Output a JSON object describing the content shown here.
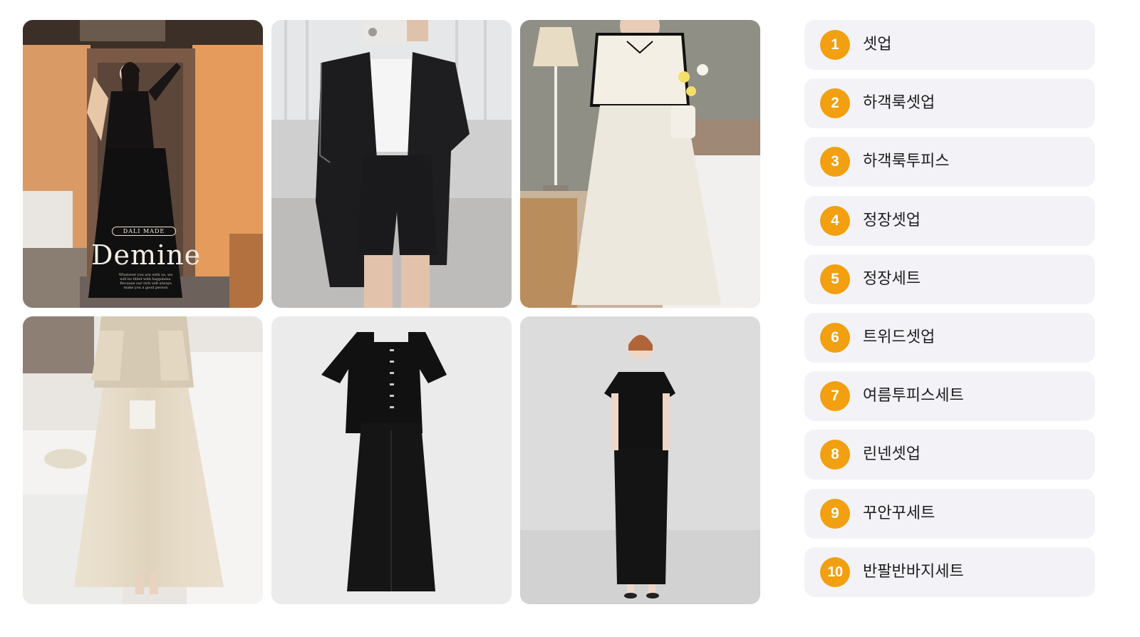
{
  "gallery": {
    "images": [
      {
        "subject": "woman in black tweed cropped jacket and skirt holding bouquet",
        "overlay": {
          "brand": "DALI MADE",
          "title": "Demine",
          "caption": "Whatever you are with us, we will be filled with happiness. Because our rich will always make you a good person"
        }
      },
      {
        "subject": "mirror selfie of black short-sleeve blazer and shorts set"
      },
      {
        "subject": "ivory cropped blouse with black trim and long mermaid skirt"
      },
      {
        "subject": "beige cropped bolero and long satin skirt set"
      },
      {
        "subject": "black square-neck top and long skirt set product shot"
      },
      {
        "subject": "model in black short-sleeve top and long skirt set"
      }
    ]
  },
  "ranking": {
    "items": [
      {
        "rank": "1",
        "label": "셋업"
      },
      {
        "rank": "2",
        "label": "하객룩셋업"
      },
      {
        "rank": "3",
        "label": "하객룩투피스"
      },
      {
        "rank": "4",
        "label": "정장셋업"
      },
      {
        "rank": "5",
        "label": "정장세트"
      },
      {
        "rank": "6",
        "label": "트위드셋업"
      },
      {
        "rank": "7",
        "label": "여름투피스세트"
      },
      {
        "rank": "8",
        "label": "린넨셋업"
      },
      {
        "rank": "9",
        "label": "꾸안꾸세트"
      },
      {
        "rank": "10",
        "label": "반팔반바지세트"
      }
    ]
  },
  "colors": {
    "badge": "#f29f10",
    "item_bg": "#f3f3f7",
    "text": "#1d1d1f"
  }
}
